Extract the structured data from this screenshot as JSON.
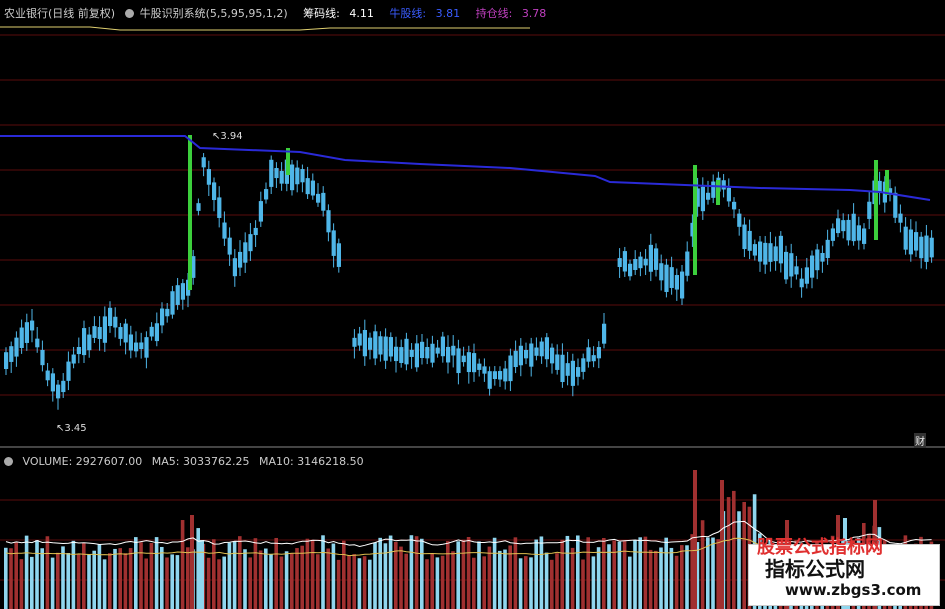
{
  "header": {
    "stock": "农业银行(日线 前复权)",
    "indicator": "牛股识别系统(5,5,95,95,1,2)",
    "chip_label": "筹码线:",
    "chip_value": "4.11",
    "bull_label": "牛股线:",
    "bull_value": "3.81",
    "hold_label": "持仓线:",
    "hold_value": "3.78"
  },
  "labels": {
    "high": "3.94",
    "low": "3.45",
    "cai": "财"
  },
  "volume_header": {
    "volume": "VOLUME: 2927607.00",
    "ma5": "MA5: 3033762.25",
    "ma10": "MA10: 3146218.50"
  },
  "watermark": {
    "title": "指标公式网",
    "url": "www.zbgs3.com",
    "behind": "股票公式指标网"
  },
  "colors": {
    "background": "#000000",
    "candle": "#4fb6e8",
    "signal": "#3ccf3c",
    "blue_line": "#2a2ad8",
    "vol_up": "#a03030",
    "vol_down": "#8fd6ee",
    "ma5": "#ffffff",
    "ma10": "#e0c050",
    "chip": "#ffffff",
    "bull": "#5080ff",
    "hold": "#c040c0"
  }
}
